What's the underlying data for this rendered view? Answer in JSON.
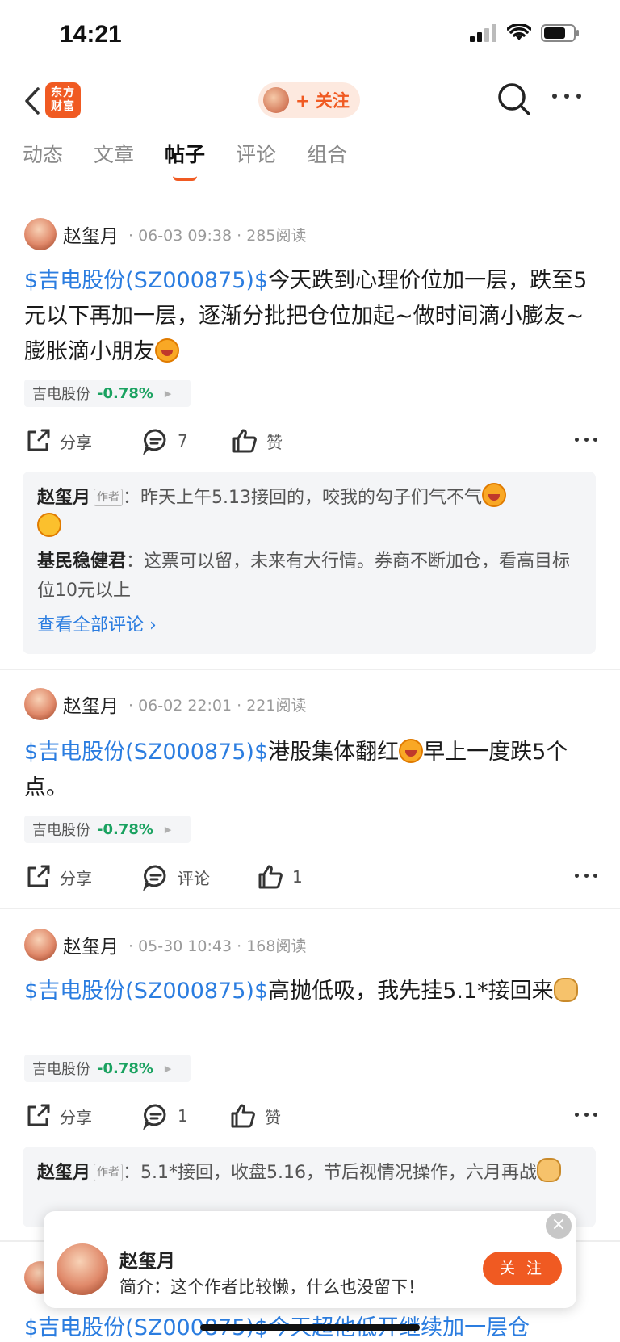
{
  "status_bar": {
    "time": "14:21"
  },
  "nav": {
    "logo_text_line1": "东方",
    "logo_text_line2": "财富",
    "follow_label": "+ 关注"
  },
  "tabs": [
    {
      "label": "动态",
      "active": false
    },
    {
      "label": "文章",
      "active": false
    },
    {
      "label": "帖子",
      "active": true
    },
    {
      "label": "评论",
      "active": false
    },
    {
      "label": "组合",
      "active": false
    }
  ],
  "posts": [
    {
      "author": "赵玺月",
      "meta": "· 06-03 09:38 · 285阅读",
      "stock_link": "$吉电股份(SZ000875)$",
      "text": "今天跌到心理价位加一层，跌至5元以下再加一层，逐渐分批把仓位加起~做时间滴小膨友~膨胀滴小朋友",
      "stock_name": "吉电股份",
      "stock_change": "-0.78%",
      "share_label": "分享",
      "comment_label": "7",
      "like_label": "赞",
      "comments": [
        {
          "name": "赵玺月",
          "badge": "作者",
          "text": "：昨天上午5.13接回的，咬我的勾子们气不气"
        },
        {
          "name": "基民稳健君",
          "badge": "",
          "text": "：这票可以留，未来有大行情。券商不断加仓，看高目标位10元以上"
        }
      ],
      "view_all": "查看全部评论 ›"
    },
    {
      "author": "赵玺月",
      "meta": "· 06-02 22:01 · 221阅读",
      "stock_link": "$吉电股份(SZ000875)$",
      "text_a": "港股集体翻红",
      "text_b": "早上一度跌5个点。",
      "stock_name": "吉电股份",
      "stock_change": "-0.78%",
      "share_label": "分享",
      "comment_label": "评论",
      "like_label": "1"
    },
    {
      "author": "赵玺月",
      "meta": "· 05-30 10:43 · 168阅读",
      "stock_link": "$吉电股份(SZ000875)$",
      "text": "高抛低吸，我先挂5.1*接回来",
      "stock_name": "吉电股份",
      "stock_change": "-0.78%",
      "share_label": "分享",
      "comment_label": "1",
      "like_label": "赞",
      "comments": [
        {
          "name": "赵玺月",
          "badge": "作者",
          "text": "：5.1*接回，收盘5.16，节后视情况操作，六月再战"
        }
      ]
    }
  ],
  "popup": {
    "name": "赵玺月",
    "intro": "简介：这个作者比较懒，什么也没留下！",
    "follow_label": "关 注",
    "close": "×"
  },
  "partial_post_text": "$吉电股份(SZ000875)$今天超他低开继续加一层仓"
}
